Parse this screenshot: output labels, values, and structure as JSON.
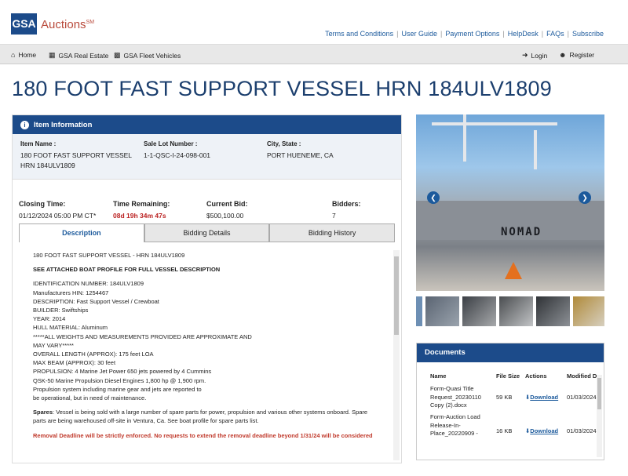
{
  "brand": {
    "logo": "GSA",
    "name": "Auctions",
    "mark": "SM"
  },
  "top_links": [
    "Terms and Conditions",
    "User Guide",
    "Payment Options",
    "HelpDesk",
    "FAQs",
    "Subscribe"
  ],
  "nav": {
    "home": "Home",
    "real_estate": "GSA Real Estate",
    "fleet": "GSA Fleet Vehicles",
    "login": "Login",
    "register": "Register"
  },
  "page_title": "180 FOOT FAST SUPPORT VESSEL HRN 184ULV1809",
  "item_info": {
    "heading": "Item Information",
    "item_name_label": "Item Name :",
    "item_name_line1": "180 FOOT FAST SUPPORT VESSEL",
    "item_name_line2": "HRN 184ULV1809",
    "lot_label": "Sale Lot Number :",
    "lot_value": "1-1-QSC-I-24-098-001",
    "city_label": "City, State :",
    "city_value": "PORT HUENEME, CA"
  },
  "stats": {
    "closing_label": "Closing Time:",
    "closing_value": "01/12/2024 05:00 PM CT*",
    "remaining_label": "Time Remaining:",
    "remaining_value": "08d 19h 34m 47s",
    "bid_label": "Current Bid:",
    "bid_value": "$500,100.00",
    "bidders_label": "Bidders:",
    "bidders_value": "7"
  },
  "tabs": [
    "Description",
    "Bidding Details",
    "Bidding History"
  ],
  "description": {
    "line1": "180 FOOT FAST SUPPORT VESSEL - HRN 184ULV1809",
    "line2": "SEE ATTACHED BOAT PROFILE FOR FULL VESSEL DESCRIPTION",
    "specs": [
      "IDENTIFICATION NUMBER: 184ULV1809",
      "Manufacturers HIN: 1254467",
      "DESCRIPTION: Fast Support Vessel / Crewboat",
      "BUILDER: Swiftships",
      "YEAR: 2014",
      "HULL MATERIAL: Aluminum",
      "*****ALL WEIGHTS AND MEASUREMENTS PROVIDED ARE APPROXIMATE AND",
      "MAY VARY*****",
      "OVERALL LENGTH (APPROX): 175 feet LOA",
      "MAX BEAM (APPROX): 30 feet",
      "PROPULSION: 4 Marine Jet Power 650 jets powered by 4 Cummins",
      "QSK-50 Marine Propulsion Diesel Engines 1,800 hp @ 1,900 rpm.",
      "Propulsion system including marine gear and jets are reported to",
      "be operational, but in need of maintenance."
    ],
    "spares_label": "Spares",
    "spares_text": ": Vessel is being sold with a large number of spare parts for power, propulsion and various other systems onboard. Spare parts are being warehoused off-site in Ventura, Ca. See boat profile for spare parts list.",
    "removal": "Removal Deadline will be strictly enforced. No requests to extend the removal deadline beyond 1/31/24 will be considered"
  },
  "carousel": {
    "boat_lettering": "NOMAD"
  },
  "documents": {
    "heading": "Documents",
    "col_name": "Name",
    "col_size": "File Size",
    "col_actions": "Actions",
    "col_modified": "Modified D",
    "rows": [
      {
        "name_l1": "Form-Quasi Title",
        "name_l2": "Request_20230110",
        "name_l3": "Copy (2).docx",
        "size": "59 KB",
        "action": "Download",
        "modified": "01/03/2024"
      },
      {
        "name_l1": "Form-Auction Load",
        "name_l2": "Release-In-",
        "name_l3": "Place_20220909 -",
        "size": "16 KB",
        "action": "Download",
        "modified": "01/03/2024"
      }
    ]
  },
  "colors": {
    "brand_blue": "#1c4b8a",
    "title_blue": "#1c3f6e",
    "link_blue": "#1c5a9c",
    "alert_red": "#c0392b"
  }
}
